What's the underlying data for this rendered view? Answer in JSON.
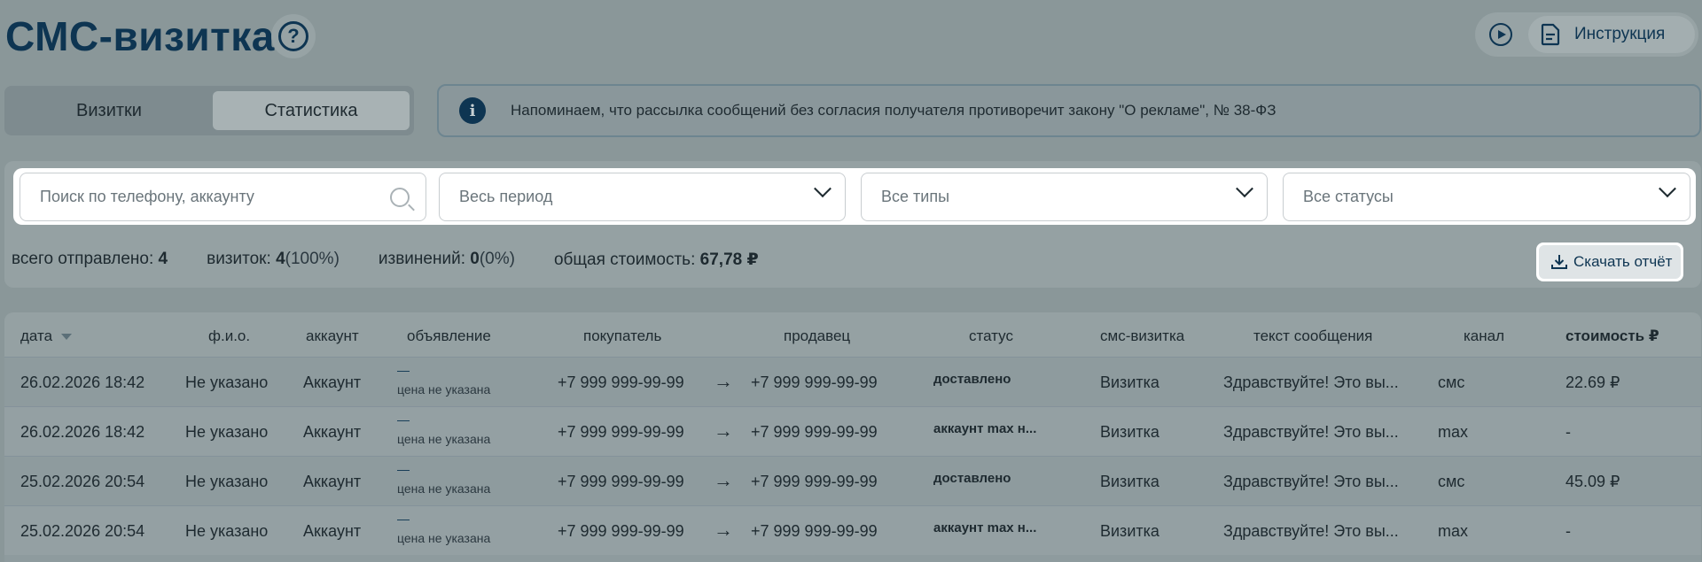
{
  "header": {
    "title": "СМС-визитка",
    "help_glyph": "?",
    "instruction_label": "Инструкция"
  },
  "tabs": [
    {
      "label": "Визитки",
      "active": false
    },
    {
      "label": "Статистика",
      "active": true
    }
  ],
  "notice": {
    "icon_glyph": "i",
    "text": "Напоминаем, что рассылка сообщений без согласия получателя противоречит закону \"О рекламе\", № 38-ФЗ"
  },
  "filters": {
    "search_placeholder": "Поиск по телефону, аккаунту",
    "period": "Весь период",
    "types": "Все типы",
    "statuses": "Все статусы"
  },
  "stats": {
    "sent_label": "всего отправлено:",
    "sent_value": "4",
    "cards_label": "визиток:",
    "cards_value": "4",
    "cards_pct": "(100%)",
    "apologies_label": "извинений:",
    "apologies_value": "0",
    "apologies_pct": "(0%)",
    "cost_label": "общая стоимость:",
    "cost_value": "67,78 ₽"
  },
  "download_label": "Скачать отчёт",
  "table": {
    "columns": [
      "дата",
      "ф.и.о.",
      "аккаунт",
      "объявление",
      "покупатель",
      "продавец",
      "статус",
      "смс-визитка",
      "текст сообщения",
      "канал",
      "стоимость ₽"
    ],
    "rows": [
      {
        "date": "26.02.2026 18:42",
        "name": "Не указано",
        "account": "Аккаунт",
        "ad_dash": "—",
        "ad_price": "цена не указана",
        "buyer": "+7 999 999-99-99",
        "arrow": "→",
        "seller": "+7 999 999-99-99",
        "status": "доставлено",
        "card": "Визитка",
        "text": "Здравствуйте! Это вы...",
        "channel": "смс",
        "cost": "22.69 ₽"
      },
      {
        "date": "26.02.2026 18:42",
        "name": "Не указано",
        "account": "Аккаунт",
        "ad_dash": "—",
        "ad_price": "цена не указана",
        "buyer": "+7 999 999-99-99",
        "arrow": "→",
        "seller": "+7 999 999-99-99",
        "status": "аккаунт max н...",
        "card": "Визитка",
        "text": "Здравствуйте! Это вы...",
        "channel": "max",
        "cost": "-"
      },
      {
        "date": "25.02.2026 20:54",
        "name": "Не указано",
        "account": "Аккаунт",
        "ad_dash": "—",
        "ad_price": "цена не указана",
        "buyer": "+7 999 999-99-99",
        "arrow": "→",
        "seller": "+7 999 999-99-99",
        "status": "доставлено",
        "card": "Визитка",
        "text": "Здравствуйте! Это вы...",
        "channel": "смс",
        "cost": "45.09 ₽"
      },
      {
        "date": "25.02.2026 20:54",
        "name": "Не указано",
        "account": "Аккаунт",
        "ad_dash": "—",
        "ad_price": "цена не указана",
        "buyer": "+7 999 999-99-99",
        "arrow": "→",
        "seller": "+7 999 999-99-99",
        "status": "аккаунт max н...",
        "card": "Визитка",
        "text": "Здравствуйте! Это вы...",
        "channel": "max",
        "cost": "-"
      }
    ]
  }
}
